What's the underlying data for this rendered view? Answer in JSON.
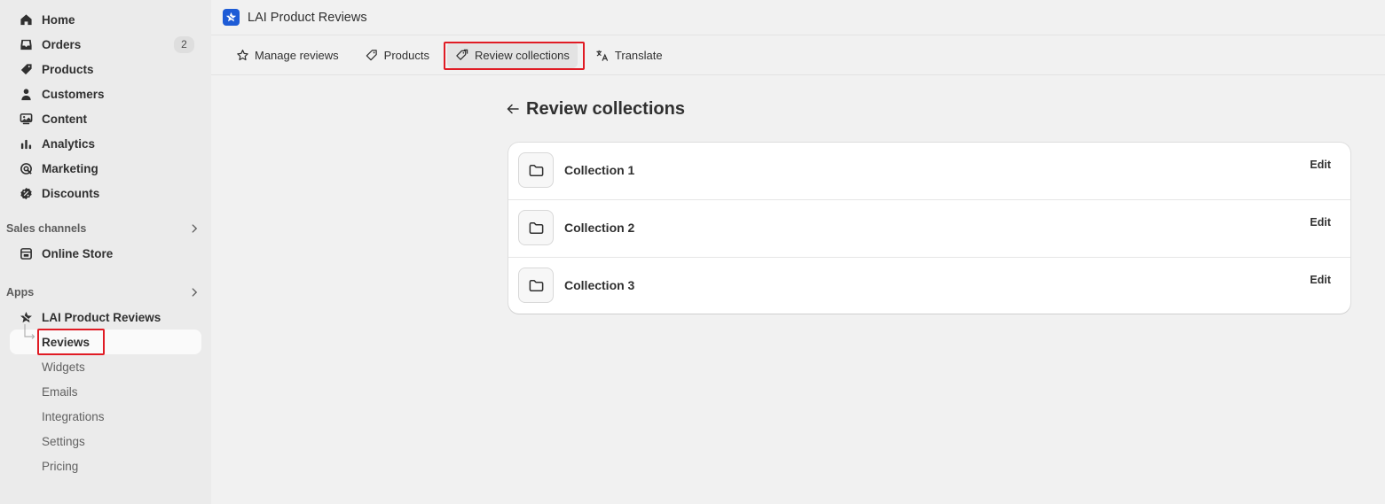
{
  "sidebar": {
    "items": [
      {
        "name": "home",
        "label": "Home",
        "icon": "home-icon"
      },
      {
        "name": "orders",
        "label": "Orders",
        "icon": "inbox-icon",
        "badge": "2"
      },
      {
        "name": "products",
        "label": "Products",
        "icon": "tag-icon"
      },
      {
        "name": "customers",
        "label": "Customers",
        "icon": "person-icon"
      },
      {
        "name": "content",
        "label": "Content",
        "icon": "image-icon"
      },
      {
        "name": "analytics",
        "label": "Analytics",
        "icon": "bar-chart-icon"
      },
      {
        "name": "marketing",
        "label": "Marketing",
        "icon": "target-icon"
      },
      {
        "name": "discounts",
        "label": "Discounts",
        "icon": "discount-icon"
      }
    ],
    "sales_channels": {
      "heading": "Sales channels",
      "items": [
        {
          "name": "online-store",
          "label": "Online Store",
          "icon": "store-icon"
        }
      ]
    },
    "apps": {
      "heading": "Apps",
      "app_name": "LAI Product Reviews",
      "sub_items": [
        {
          "name": "reviews",
          "label": "Reviews",
          "active": true
        },
        {
          "name": "widgets",
          "label": "Widgets"
        },
        {
          "name": "emails",
          "label": "Emails"
        },
        {
          "name": "integrations",
          "label": "Integrations"
        },
        {
          "name": "settings",
          "label": "Settings"
        },
        {
          "name": "pricing",
          "label": "Pricing"
        }
      ]
    }
  },
  "topbar": {
    "app_title": "LAI Product Reviews"
  },
  "tabs": [
    {
      "name": "manage-reviews",
      "label": "Manage reviews",
      "icon": "star-icon"
    },
    {
      "name": "products",
      "label": "Products",
      "icon": "tag-icon"
    },
    {
      "name": "review-collections",
      "label": "Review collections",
      "icon": "tags-icon",
      "active": true
    },
    {
      "name": "translate",
      "label": "Translate",
      "icon": "translate-icon"
    }
  ],
  "page": {
    "title": "Review collections",
    "collections": [
      {
        "name": "Collection 1",
        "action": "Edit"
      },
      {
        "name": "Collection 2",
        "action": "Edit"
      },
      {
        "name": "Collection 3",
        "action": "Edit"
      }
    ]
  },
  "colors": {
    "highlight": "#e01b24",
    "app_logo": "#1d5bd6",
    "sidebar_bg": "#ebebeb",
    "page_bg": "#f1f1f1"
  }
}
